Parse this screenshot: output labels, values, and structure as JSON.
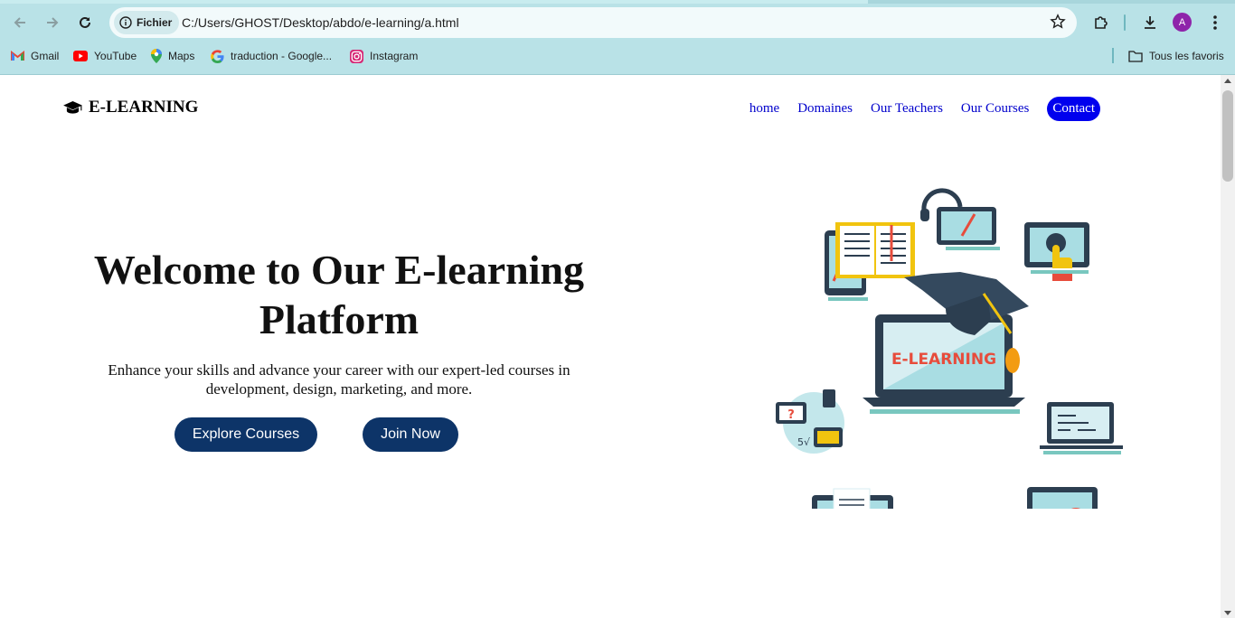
{
  "browser": {
    "security_chip": "Fichier",
    "url": "C:/Users/GHOST/Desktop/abdo/e-learning/a.html",
    "profile_initial": "A",
    "bookmarks": [
      {
        "label": "Gmail",
        "icon": "gmail-icon"
      },
      {
        "label": "YouTube",
        "icon": "youtube-icon"
      },
      {
        "label": "Maps",
        "icon": "maps-icon"
      },
      {
        "label": "traduction - Google...",
        "icon": "google-icon"
      },
      {
        "label": "Instagram",
        "icon": "instagram-icon"
      }
    ],
    "all_bookmarks": "Tous les favoris"
  },
  "site": {
    "logo_text": "E-LEARNING",
    "nav": {
      "home": "home",
      "domaines": "Domaines",
      "teachers": "Our Teachers",
      "courses": "Our Courses",
      "contact": "Contact"
    },
    "hero": {
      "title": "Welcome to Our E-learning Platform",
      "subtitle": "Enhance your skills and advance your career with our expert-led courses in development, design, marketing, and more.",
      "explore_label": "Explore Courses",
      "join_label": "Join Now"
    },
    "illustration": {
      "laptop_text": "E-LEARNING"
    }
  },
  "colors": {
    "chrome": "#b9e2e7",
    "nav_link": "#0000cc",
    "contact_bg": "#0000ee",
    "button_bg": "#0d3468"
  }
}
